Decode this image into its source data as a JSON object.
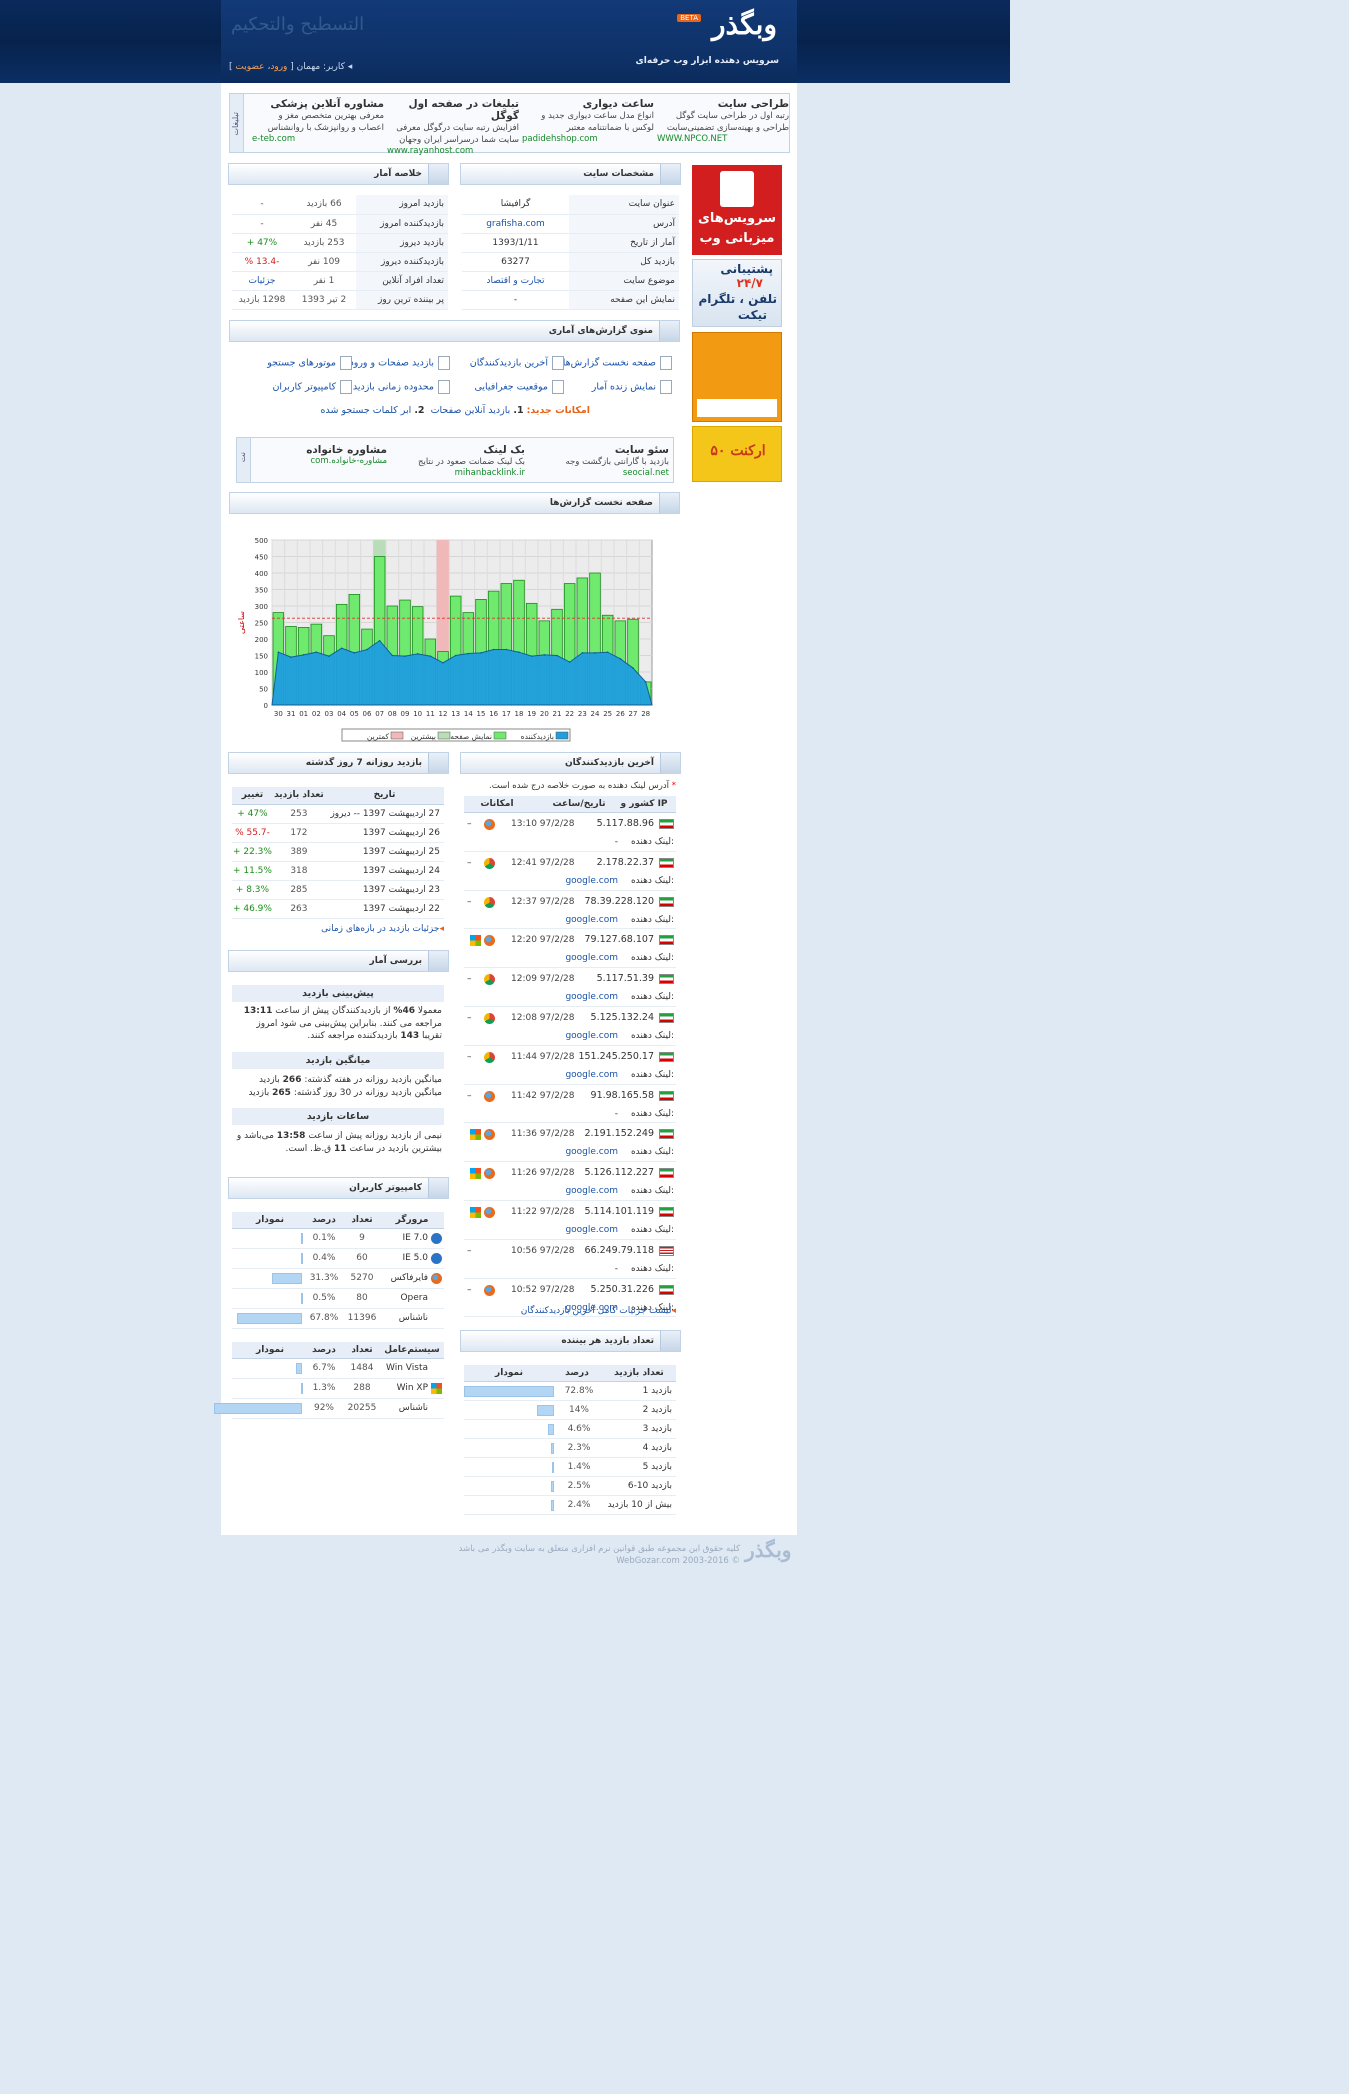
{
  "header": {
    "logo": "وبگذر",
    "beta": "BETA",
    "tagline": "سرویس دهنده ابزار وب حرفه‌ای",
    "calligraphy": "التسطيح والتحكيم",
    "user_prefix": "کاربر: مهمان [",
    "login": "ورود",
    "sep": "،",
    "register": "عضویت",
    "user_suffix": "]"
  },
  "ads_top": {
    "side_label": "تبلیغات",
    "items": [
      {
        "title": "طراحی سایت",
        "desc": "رتبه اول در طراحی سایت گوگل طراحی و بهینه‌سازی تضمینی‌سایت",
        "url": "WWW.NPCO.NET"
      },
      {
        "title": "ساعت دیواری",
        "desc": "انواع مدل ساعت دیواری جدید و لوکس با ضمانتنامه معتبر",
        "url": "padidehshop.com"
      },
      {
        "title": "تبلیغات در صفحه اول گوگل",
        "desc": "افزایش رتبه سایت درگوگل معرفی سایت شما درسراسر ایران وجهان",
        "url": "www.rayanhost.com"
      },
      {
        "title": "مشاوره آنلاین پزشکی",
        "desc": "معرفی بهترین متخصص مغز و اعصاب و روانپزشک با روانشناس",
        "url": "e-teb.com"
      }
    ]
  },
  "side_ads": {
    "hosting_line1": "سرویس‌های",
    "hosting_line2": "میزبانی وب",
    "support_1": "پشتیبانی",
    "support_2": "۲۴/۷",
    "support_3": "تلفن ، تلگرام",
    "support_4": "تیکت",
    "ad4_text": "۵۰ ارکنت"
  },
  "site_info": {
    "title": "مشخصات سایت",
    "rows": [
      {
        "label": "عنوان سایت",
        "value": "گرافیشا"
      },
      {
        "label": "آدرس",
        "value": "grafisha.com"
      },
      {
        "label": "آمار از تاریخ",
        "value": "1393/1/11"
      },
      {
        "label": "بازدید کل",
        "value": "63277"
      },
      {
        "label": "موضوع سایت",
        "value": "تجارت و اقتصاد"
      },
      {
        "label": "نمایش این صفحه",
        "value": "-"
      }
    ]
  },
  "summary": {
    "title": "خلاصه آمار",
    "rows": [
      {
        "label": "بازدید امروز",
        "value": "66 بازدید",
        "change": "-"
      },
      {
        "label": "بازدیدکننده امروز",
        "value": "45 نفر",
        "change": "-"
      },
      {
        "label": "بازدید دیروز",
        "value": "253 بازدید",
        "change": "47% +"
      },
      {
        "label": "بازدیدکننده دیروز",
        "value": "109 نفر",
        "change": "-13.4 %"
      },
      {
        "label": "تعداد افراد آنلاین",
        "value": "1 نفر",
        "change": "جزئیات"
      },
      {
        "label": "پر بیننده ترین روز",
        "value": "2 تیر 1393",
        "change": "1298 بازدید"
      }
    ]
  },
  "menu": {
    "title": "منوی گزارش‌های آماری",
    "items": [
      "صفحه نخست گزارش‌ها",
      "آخرین بازدیدکنندگان",
      "بازدید صفحات و ورودی",
      "موتورهای جستجو",
      "نمایش زنده آمار",
      "موقعیت جغرافیایی",
      "محدوده زمانی بازدید",
      "کامپیوتر کاربران"
    ],
    "new_label": "امکانات جدید:",
    "new_1_num": "1.",
    "new_1": "بازدید آنلاین صفحات",
    "new_2_num": "2.",
    "new_2": "ابر کلمات جستجو شده"
  },
  "ads_mid": {
    "side_label": "نت",
    "items": [
      {
        "title": "سئو سایت",
        "desc": "بازدید با گارانتی بازگشت وجه",
        "url": "seocial.net"
      },
      {
        "title": "بک لینک",
        "desc": "بک لینک ضمانت صعود در نتایج",
        "url": "mihanbacklink.ir"
      },
      {
        "title": "مشاوره خانواده",
        "desc": "",
        "url": "مشاوره-خانواده.com"
      }
    ]
  },
  "chart_section": {
    "title": "صفحه نخست گزارش‌ها"
  },
  "chart_data": {
    "type": "bar",
    "ylabel": "ساعتی",
    "ylim": [
      0,
      500
    ],
    "yticks": [
      "500",
      "450",
      "400",
      "350",
      "300",
      "250",
      "200",
      "150",
      "100",
      "50",
      "0"
    ],
    "categories": [
      "30",
      "31",
      "01",
      "02",
      "03",
      "04",
      "05",
      "06",
      "07",
      "08",
      "09",
      "10",
      "11",
      "12",
      "13",
      "14",
      "15",
      "16",
      "17",
      "18",
      "19",
      "20",
      "21",
      "22",
      "23",
      "24",
      "25",
      "26",
      "27",
      "28"
    ],
    "series": [
      {
        "name": "نمایش صفحه",
        "values": [
          280,
          238,
          235,
          245,
          210,
          305,
          335,
          230,
          450,
          300,
          318,
          298,
          200,
          162,
          330,
          280,
          320,
          345,
          368,
          378,
          308,
          255,
          290,
          368,
          385,
          400,
          272,
          255,
          260,
          70
        ]
      },
      {
        "name": "بازدیدکننده",
        "values": [
          160,
          145,
          152,
          160,
          148,
          172,
          158,
          168,
          195,
          150,
          148,
          155,
          148,
          128,
          150,
          156,
          158,
          168,
          168,
          160,
          148,
          152,
          150,
          130,
          158,
          158,
          160,
          140,
          112,
          70
        ]
      }
    ],
    "highlight_max": "07",
    "highlight_min": "12",
    "avg": 263,
    "legend": [
      "بازدیدکننده",
      "نمایش صفحه",
      "بیشترین",
      "کمترین"
    ],
    "colors": {
      "views": "#6fea6f",
      "visitors": "#1e9fde",
      "max": "#b8ddb8",
      "min": "#f0b8b8"
    }
  },
  "daily": {
    "title": "بازدید روزانه 7 روز گذشته",
    "headers": [
      "تاریخ",
      "تعداد بازدید",
      "تغییر"
    ],
    "rows": [
      {
        "date": "27 اردیبهشت 1397 -- دیروز",
        "count": "253",
        "change": "47% +",
        "color": "green"
      },
      {
        "date": "26 اردیبهشت 1397",
        "count": "172",
        "change": "-55.7 %",
        "color": "red"
      },
      {
        "date": "25 اردیبهشت 1397",
        "count": "389",
        "change": "22.3% +",
        "color": "green"
      },
      {
        "date": "24 اردیبهشت 1397",
        "count": "318",
        "change": "11.5% +",
        "color": "green"
      },
      {
        "date": "23 اردیبهشت 1397",
        "count": "285",
        "change": "8.3% +",
        "color": "green"
      },
      {
        "date": "22 اردیبهشت 1397",
        "count": "263",
        "change": "46.9% +",
        "color": "green"
      }
    ],
    "footer": "جزئیات بازدید در بازه‌های زمانی"
  },
  "review": {
    "title": "بررسی آمار",
    "pred_title": "پیش‌بینی بازدید",
    "pred_1": "معمولا",
    "pred_pct": "46%",
    "pred_2": "از بازدیدکنندگان پیش از ساعت",
    "pred_time": "13:11",
    "pred_3": "مراجعه می کنند. بنابراین پیش‌بینی می شود امروز تقریبا",
    "pred_num": "143",
    "pred_4": "بازدیدکننده مراجعه کنند.",
    "avg_title": "میانگین بازدید",
    "avg_1": "میانگین بازدید روزانه در هفته گذشته:",
    "avg_week": "266",
    "avg_unit": "بازدید",
    "avg_2": "میانگین بازدید روزانه در 30 روز گذشته:",
    "avg_month": "265",
    "hours_title": "ساعات بازدید",
    "hours_1": "نیمی از بازدید روزانه پیش از ساعت",
    "hours_time": "13:58",
    "hours_2": "می‌باشد و بیشترین بازدید در ساعت",
    "hours_peak": "11",
    "hours_3": "ق.ظ. است."
  },
  "computers": {
    "title": "کامپیوتر کاربران",
    "browser_headers": [
      "مرورگر",
      "تعداد",
      "درصد",
      "نمودار"
    ],
    "browsers": [
      {
        "name": "IE 7.0",
        "icon": "ie-icon",
        "count": "9",
        "pct": "0.1%",
        "frac": 0.001
      },
      {
        "name": "IE 5.0",
        "icon": "ie-icon",
        "count": "60",
        "pct": "0.4%",
        "frac": 0.004
      },
      {
        "name": "فایرفاکس",
        "icon": "firefox-icon",
        "count": "5270",
        "pct": "31.3%",
        "frac": 0.313
      },
      {
        "name": "Opera",
        "icon": "",
        "count": "80",
        "pct": "0.5%",
        "frac": 0.005
      },
      {
        "name": "ناشناس",
        "icon": "",
        "count": "11396",
        "pct": "67.8%",
        "frac": 0.678
      }
    ],
    "os_headers": [
      "سیستم‌عامل",
      "تعداد",
      "درصد",
      "نمودار"
    ],
    "os": [
      {
        "name": "Win Vista",
        "count": "1484",
        "pct": "6.7%",
        "frac": 0.067
      },
      {
        "name": "Win XP",
        "count": "288",
        "pct": "1.3%",
        "frac": 0.013
      },
      {
        "name": "ناشناس",
        "count": "20255",
        "pct": "92%",
        "frac": 0.92
      }
    ]
  },
  "recent": {
    "title": "آخرین بازدیدکنندگان",
    "note_star": "*",
    "note": "آدرس لینک دهنده به صورت خلاصه درج شده است.",
    "headers": [
      "کشور و IP",
      "تاریخ/ساعت",
      "امکانات"
    ],
    "ref_label": "لینک دهنده:",
    "rows": [
      {
        "ip": "5.117.88.96",
        "time": "13:10 97/2/28",
        "ref": "-",
        "br": "ff",
        "win": false,
        "us": false
      },
      {
        "ip": "2.178.22.37",
        "time": "12:41 97/2/28",
        "ref": "google.com",
        "br": "ch",
        "win": false,
        "us": false
      },
      {
        "ip": "78.39.228.120",
        "time": "12:37 97/2/28",
        "ref": "google.com",
        "br": "ch",
        "win": false,
        "us": false
      },
      {
        "ip": "79.127.68.107",
        "time": "12:20 97/2/28",
        "ref": "google.com",
        "br": "ff",
        "win": true,
        "us": false
      },
      {
        "ip": "5.117.51.39",
        "time": "12:09 97/2/28",
        "ref": "google.com",
        "br": "ch",
        "win": false,
        "us": false
      },
      {
        "ip": "5.125.132.24",
        "time": "12:08 97/2/28",
        "ref": "google.com",
        "br": "ch",
        "win": false,
        "us": false
      },
      {
        "ip": "151.245.250.17",
        "time": "11:44 97/2/28",
        "ref": "google.com",
        "br": "ch",
        "win": false,
        "us": false
      },
      {
        "ip": "91.98.165.58",
        "time": "11:42 97/2/28",
        "ref": "-",
        "br": "ff",
        "win": false,
        "us": false
      },
      {
        "ip": "2.191.152.249",
        "time": "11:36 97/2/28",
        "ref": "google.com",
        "br": "ff",
        "win": true,
        "us": false
      },
      {
        "ip": "5.126.112.227",
        "time": "11:26 97/2/28",
        "ref": "google.com",
        "br": "ff",
        "win": true,
        "us": false
      },
      {
        "ip": "5.114.101.119",
        "time": "11:22 97/2/28",
        "ref": "google.com",
        "br": "ff",
        "win": true,
        "us": false
      },
      {
        "ip": "66.249.79.118",
        "time": "10:56 97/2/28",
        "ref": "-",
        "br": "",
        "win": false,
        "us": true
      },
      {
        "ip": "5.250.31.226",
        "time": "10:52 97/2/28",
        "ref": "google.com",
        "br": "ff",
        "win": false,
        "us": false
      }
    ],
    "footer": "لیست جزئیات کامل آخرین بازدیدکنندگان"
  },
  "per_visitor": {
    "title": "تعداد بازدید هر بیننده",
    "headers": [
      "تعداد بازدید",
      "درصد",
      "نمودار"
    ],
    "rows": [
      {
        "label": "1 بازدید",
        "pct": "72.8%",
        "frac": 0.728
      },
      {
        "label": "2 بازدید",
        "pct": "14%",
        "frac": 0.14
      },
      {
        "label": "3 بازدید",
        "pct": "4.6%",
        "frac": 0.046
      },
      {
        "label": "4 بازدید",
        "pct": "2.3%",
        "frac": 0.023
      },
      {
        "label": "5 بازدید",
        "pct": "1.4%",
        "frac": 0.014
      },
      {
        "label": "6-10 بازدید",
        "pct": "2.5%",
        "frac": 0.025
      },
      {
        "label": "بیش از 10 بازدید",
        "pct": "2.4%",
        "frac": 0.024
      }
    ]
  },
  "footer": {
    "logo": "وبگذر",
    "line1": "کلیه حقوق این مجموعه طبق قوانین نرم افزاری متعلق به سایت وبگذر می باشد",
    "line2": "© 2003-2016 WebGozar.com"
  }
}
